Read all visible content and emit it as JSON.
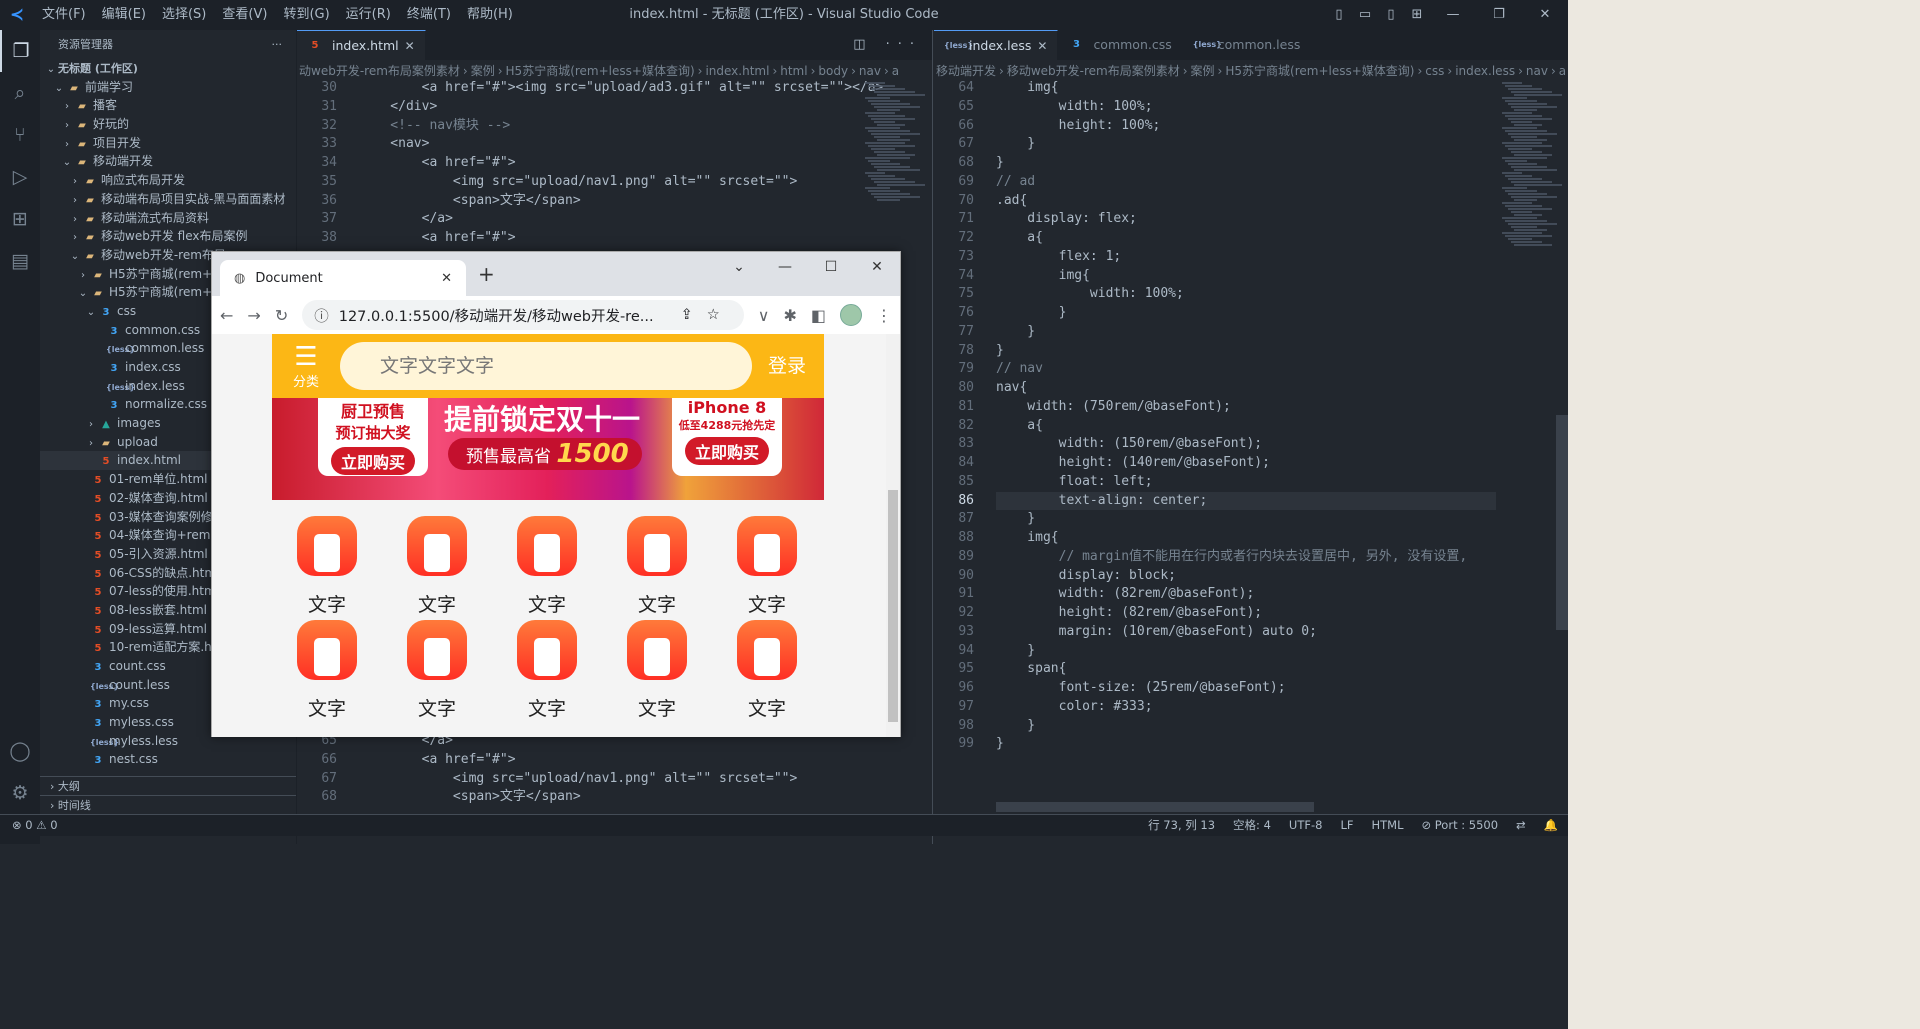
{
  "titlebar": {
    "menu": [
      "文件(F)",
      "编辑(E)",
      "选择(S)",
      "查看(V)",
      "转到(G)",
      "运行(R)",
      "终端(T)",
      "帮助(H)"
    ],
    "title": "index.html - 无标题 (工作区) - Visual Studio Code"
  },
  "sidebar": {
    "header": "资源管理器",
    "workspace": "无标题 (工作区)",
    "rows": [
      {
        "indent": 1,
        "tw": "⌄",
        "kind": "folder",
        "label": "前端学习"
      },
      {
        "indent": 2,
        "tw": "›",
        "kind": "folder",
        "label": "播客"
      },
      {
        "indent": 2,
        "tw": "›",
        "kind": "folder",
        "label": "好玩的"
      },
      {
        "indent": 2,
        "tw": "›",
        "kind": "folder",
        "label": "项目开发"
      },
      {
        "indent": 2,
        "tw": "⌄",
        "kind": "folder",
        "label": "移动端开发"
      },
      {
        "indent": 3,
        "tw": "›",
        "kind": "folder",
        "label": "响应式布局开发"
      },
      {
        "indent": 3,
        "tw": "›",
        "kind": "folder",
        "label": "移动端布局项目实战-黑马面面素材"
      },
      {
        "indent": 3,
        "tw": "›",
        "kind": "folder",
        "label": "移动端流式布局资料"
      },
      {
        "indent": 3,
        "tw": "›",
        "kind": "folder",
        "label": "移动web开发 flex布局案例"
      },
      {
        "indent": 3,
        "tw": "⌄",
        "kind": "folder",
        "label": "移动web开发-rem布局"
      },
      {
        "indent": 4,
        "tw": "›",
        "kind": "folder",
        "label": "H5苏宁商城(rem+flex"
      },
      {
        "indent": 4,
        "tw": "⌄",
        "kind": "folder",
        "label": "H5苏宁商城(rem+less"
      },
      {
        "indent": 5,
        "tw": "⌄",
        "kind": "css",
        "label": "css"
      },
      {
        "indent": 6,
        "tw": "",
        "kind": "css",
        "label": "common.css"
      },
      {
        "indent": 6,
        "tw": "",
        "kind": "less",
        "label": "common.less"
      },
      {
        "indent": 6,
        "tw": "",
        "kind": "css",
        "label": "index.css"
      },
      {
        "indent": 6,
        "tw": "",
        "kind": "less",
        "label": "index.less"
      },
      {
        "indent": 6,
        "tw": "",
        "kind": "css",
        "label": "normalize.css"
      },
      {
        "indent": 5,
        "tw": "›",
        "kind": "img",
        "label": "images"
      },
      {
        "indent": 5,
        "tw": "›",
        "kind": "folder",
        "label": "upload"
      },
      {
        "indent": 5,
        "tw": "",
        "kind": "html",
        "label": "index.html",
        "selected": true
      },
      {
        "indent": 4,
        "tw": "",
        "kind": "html",
        "label": "01-rem单位.html"
      },
      {
        "indent": 4,
        "tw": "",
        "kind": "html",
        "label": "02-媒体查询.html"
      },
      {
        "indent": 4,
        "tw": "",
        "kind": "html",
        "label": "03-媒体查询案例修改"
      },
      {
        "indent": 4,
        "tw": "",
        "kind": "html",
        "label": "04-媒体查询+rem实"
      },
      {
        "indent": 4,
        "tw": "",
        "kind": "html",
        "label": "05-引入资源.html"
      },
      {
        "indent": 4,
        "tw": "",
        "kind": "html",
        "label": "06-CSS的缺点.html"
      },
      {
        "indent": 4,
        "tw": "",
        "kind": "html",
        "label": "07-less的使用.html"
      },
      {
        "indent": 4,
        "tw": "",
        "kind": "html",
        "label": "08-less嵌套.html"
      },
      {
        "indent": 4,
        "tw": "",
        "kind": "html",
        "label": "09-less运算.html"
      },
      {
        "indent": 4,
        "tw": "",
        "kind": "html",
        "label": "10-rem适配方案.html"
      },
      {
        "indent": 4,
        "tw": "",
        "kind": "css",
        "label": "count.css"
      },
      {
        "indent": 4,
        "tw": "",
        "kind": "less",
        "label": "count.less"
      },
      {
        "indent": 4,
        "tw": "",
        "kind": "css",
        "label": "my.css"
      },
      {
        "indent": 4,
        "tw": "",
        "kind": "css",
        "label": "myless.css"
      },
      {
        "indent": 4,
        "tw": "",
        "kind": "less",
        "label": "myless.less"
      },
      {
        "indent": 4,
        "tw": "",
        "kind": "css",
        "label": "nest.css"
      }
    ],
    "outline": "大纲",
    "timeline": "时间线"
  },
  "left_editor": {
    "tab": "index.html",
    "breadcrumb": [
      "动web开发-rem布局案例素材",
      "案例",
      "H5苏宁商城(rem+less+媒体查询)",
      "index.html",
      "html",
      "body",
      "nav",
      "a"
    ],
    "lines": [
      {
        "n": "30",
        "t": "        <a href=\"#\"><img src=\"upload/ad3.gif\" alt=\"\" srcset=\"\"></a>"
      },
      {
        "n": "31",
        "t": "    </div>"
      },
      {
        "n": "32",
        "t": "    <!-- nav模块 -->"
      },
      {
        "n": "33",
        "t": "    <nav>"
      },
      {
        "n": "34",
        "t": "        <a href=\"#\">"
      },
      {
        "n": "35",
        "t": "            <img src=\"upload/nav1.png\" alt=\"\" srcset=\"\">"
      },
      {
        "n": "36",
        "t": "            <span>文字</span>"
      },
      {
        "n": "37",
        "t": "        </a>"
      },
      {
        "n": "38",
        "t": "        <a href=\"#\">"
      }
    ],
    "lines_bottom": [
      {
        "n": "65",
        "t": "        </a>"
      },
      {
        "n": "66",
        "t": "        <a href=\"#\">"
      },
      {
        "n": "67",
        "t": "            <img src=\"upload/nav1.png\" alt=\"\" srcset=\"\">"
      },
      {
        "n": "68",
        "t": "            <span>文字</span>"
      }
    ]
  },
  "right_editor": {
    "tabs": [
      "index.less",
      "common.css",
      "common.less"
    ],
    "breadcrumb": [
      "移动端开发",
      "移动web开发-rem布局案例素材",
      "案例",
      "H5苏宁商城(rem+less+媒体查询)",
      "css",
      "index.less",
      "nav",
      "a"
    ],
    "lines": [
      {
        "n": "64",
        "t": "    img{"
      },
      {
        "n": "65",
        "t": "        width: 100%;"
      },
      {
        "n": "66",
        "t": "        height: 100%;"
      },
      {
        "n": "67",
        "t": "    }"
      },
      {
        "n": "68",
        "t": "}"
      },
      {
        "n": "69",
        "t": "// ad"
      },
      {
        "n": "70",
        "t": ".ad{"
      },
      {
        "n": "71",
        "t": "    display: flex;"
      },
      {
        "n": "72",
        "t": "    a{"
      },
      {
        "n": "73",
        "t": "        flex: 1;"
      },
      {
        "n": "74",
        "t": "        img{"
      },
      {
        "n": "75",
        "t": "            width: 100%;"
      },
      {
        "n": "76",
        "t": "        }"
      },
      {
        "n": "77",
        "t": "    }"
      },
      {
        "n": "78",
        "t": "}"
      },
      {
        "n": "79",
        "t": "// nav"
      },
      {
        "n": "80",
        "t": "nav{"
      },
      {
        "n": "81",
        "t": "    width: (750rem/@baseFont);"
      },
      {
        "n": "82",
        "t": "    a{"
      },
      {
        "n": "83",
        "t": "        width: (150rem/@baseFont);"
      },
      {
        "n": "84",
        "t": "        height: (140rem/@baseFont);"
      },
      {
        "n": "85",
        "t": "        float: left;"
      },
      {
        "n": "86",
        "t": "        text-align: center;",
        "current": true
      },
      {
        "n": "87",
        "t": "    }"
      },
      {
        "n": "88",
        "t": "    img{"
      },
      {
        "n": "89",
        "t": "        // margin值不能用在行内或者行内块去设置居中, 另外, 没有设置,"
      },
      {
        "n": "90",
        "t": "        display: block;"
      },
      {
        "n": "91",
        "t": "        width: (82rem/@baseFont);"
      },
      {
        "n": "92",
        "t": "        height: (82rem/@baseFont);"
      },
      {
        "n": "93",
        "t": "        margin: (10rem/@baseFont) auto 0;"
      },
      {
        "n": "94",
        "t": "    }"
      },
      {
        "n": "95",
        "t": "    span{"
      },
      {
        "n": "96",
        "t": "        font-size: (25rem/@baseFont);"
      },
      {
        "n": "97",
        "t": "        color: #333;"
      },
      {
        "n": "98",
        "t": "    }"
      },
      {
        "n": "99",
        "t": "}"
      }
    ]
  },
  "statusbar": {
    "problems": "⊗ 0 ⚠ 0",
    "items": [
      "行 73, 列 13",
      "空格: 4",
      "UTF-8",
      "LF",
      "HTML",
      "⊘ Port : 5500",
      "⇄",
      "🔔"
    ]
  },
  "browser": {
    "tab_title": "Document",
    "url": "127.0.0.1:5500/移动端开发/移动web开发-re...",
    "page": {
      "category": "分类",
      "search_placeholder": "文字文字文字",
      "login": "登录",
      "ad": {
        "left_top": "厨卫预售",
        "left_sub": "预订抽大奖",
        "left_btn": "立即购买",
        "center_big": "提前锁定双十一",
        "center_pill": "预售最高省",
        "center_num": "1500",
        "right_top": "iPhone 8",
        "right_sub": "低至4288元抢先定",
        "right_btn": "立即购买"
      },
      "nav_label": "文字",
      "nav_count": 10
    }
  },
  "colors": {
    "editor_bg": "#22272e",
    "accent": "#539bf5",
    "header_yellow": "#fcb715",
    "nav_icon": "#ff4b2b"
  }
}
